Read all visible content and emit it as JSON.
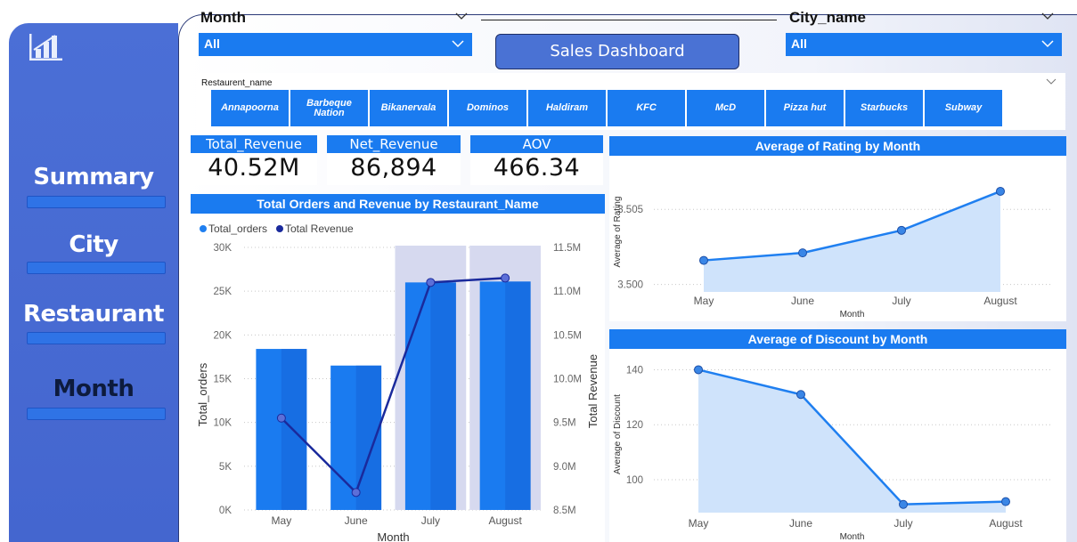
{
  "sidebar": {
    "icon": "bar-chart-icon",
    "items": [
      {
        "label": "Summary",
        "color": "#ffffff"
      },
      {
        "label": "City",
        "color": "#ffffff"
      },
      {
        "label": "Restaurant",
        "color": "#ffffff"
      },
      {
        "label": "Month",
        "color": "#0d1b3d"
      }
    ]
  },
  "slicers": {
    "month": {
      "title": "Month",
      "value": "All"
    },
    "city": {
      "title": "City_name",
      "value": "All"
    }
  },
  "dashboard_title": "Sales Dashboard",
  "restaurant_slicer": {
    "label": "Restaurent_name",
    "items": [
      "Annapoorna",
      "Barbeque Nation",
      "Bikanervala",
      "Dominos",
      "Haldiram",
      "KFC",
      "McD",
      "Pizza hut",
      "Starbucks",
      "Subway"
    ]
  },
  "kpis": [
    {
      "label": "Total_Revenue",
      "value": "40.52M"
    },
    {
      "label": "Net_Revenue",
      "value": "86,894"
    },
    {
      "label": "AOV",
      "value": "466.34"
    }
  ],
  "colors": {
    "accent": "#1a7bf0",
    "sidebar": "#4a6ed5",
    "bar": "#1a7bf0",
    "line_dark": "#1a2a9c",
    "line": "#1f7ff0",
    "area": "#cfe3fb"
  },
  "chart_data": [
    {
      "type": "bar",
      "title": "Total Orders and Revenue by Restaurant_Name",
      "legend": [
        "Total_orders",
        "Total Revenue"
      ],
      "legend_placement": "top-left",
      "xlabel": "Month",
      "ylabel": "Total_orders",
      "y2label": "Total Revenue",
      "categories": [
        "May",
        "June",
        "July",
        "August"
      ],
      "ylim": [
        0,
        30000
      ],
      "y_ticks": [
        "0K",
        "5K",
        "10K",
        "15K",
        "20K",
        "25K",
        "30K"
      ],
      "y2lim": [
        8500000,
        11500000
      ],
      "y2_ticks": [
        "8.5M",
        "9.0M",
        "9.5M",
        "10.0M",
        "10.5M",
        "11.0M",
        "11.5M"
      ],
      "series": [
        {
          "name": "Total_orders",
          "type": "bar",
          "values": [
            18400,
            16500,
            26000,
            26100
          ]
        },
        {
          "name": "Total Revenue",
          "type": "line",
          "axis": "right",
          "values": [
            9550000,
            8700000,
            11100000,
            11150000
          ]
        }
      ]
    },
    {
      "type": "area",
      "title": "Average of Rating by Month",
      "xlabel": "Month",
      "ylabel": "Average of Rating",
      "categories": [
        "May",
        "June",
        "July",
        "August"
      ],
      "ylim": [
        3.4995,
        3.5075
      ],
      "y_ticks": [
        "3.500",
        "3.505"
      ],
      "y_tick_values": [
        3.5,
        3.505
      ],
      "series": [
        {
          "values": [
            3.5016,
            3.5021,
            3.5036,
            3.5062
          ]
        }
      ]
    },
    {
      "type": "area",
      "title": "Average of Discount by Month",
      "xlabel": "Month",
      "ylabel": "Average of Discount",
      "categories": [
        "May",
        "June",
        "July",
        "August"
      ],
      "ylim": [
        88,
        145
      ],
      "y_ticks": [
        "100",
        "120",
        "140"
      ],
      "y_tick_values": [
        100,
        120,
        140
      ],
      "series": [
        {
          "values": [
            140,
            131,
            91,
            92
          ]
        }
      ]
    }
  ]
}
